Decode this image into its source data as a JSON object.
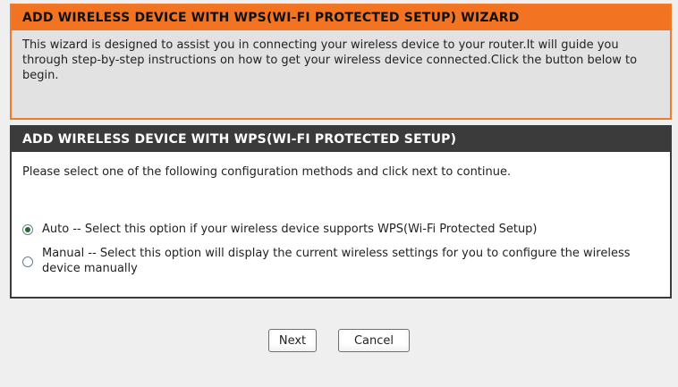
{
  "wizard": {
    "title": "ADD WIRELESS DEVICE WITH WPS(WI-FI PROTECTED SETUP) WIZARD",
    "description": "This wizard is designed to assist you in connecting your wireless device to your router.It will guide you through step-by-step instructions on how to get your wireless device connected.Click the button below to begin."
  },
  "setup": {
    "title": "ADD WIRELESS DEVICE WITH WPS(WI-FI PROTECTED SETUP)",
    "instructions": "Please select one of the following configuration methods and click next to continue.",
    "options": [
      {
        "label": "Auto -- Select this option if your wireless device supports WPS(Wi-Fi Protected Setup)",
        "selected": true
      },
      {
        "label": "Manual -- Select this option will display the current wireless settings for you to configure the wireless device manually",
        "selected": false
      }
    ]
  },
  "buttons": {
    "next": "Next",
    "cancel": "Cancel"
  },
  "colors": {
    "wizard_header": "#f27321",
    "setup_header": "#3b3b3b",
    "page_background": "#efefef"
  }
}
